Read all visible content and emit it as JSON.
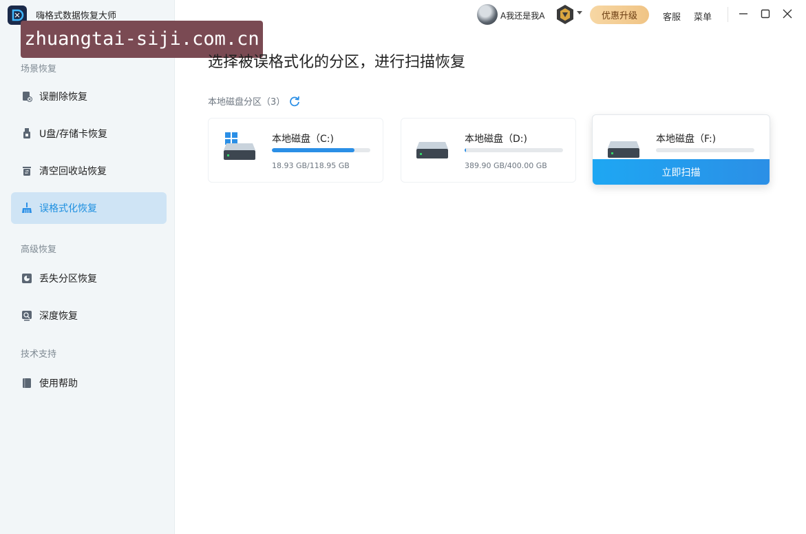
{
  "app": {
    "title": "嗨格式数据恢复大师",
    "logo_letter": "D",
    "watermark": "zhuangtai-siji.com.cn"
  },
  "header": {
    "username": "A我还是我A",
    "upgrade_label": "优惠升级",
    "service_label": "客服",
    "menu_label": "菜单"
  },
  "sidebar": {
    "section_scene": "场景恢复",
    "section_advanced": "高级恢复",
    "section_support": "技术支持",
    "items": [
      {
        "label": "误删除恢复",
        "icon": "file-delete-icon"
      },
      {
        "label": "U盘/存储卡恢复",
        "icon": "usb-drive-icon"
      },
      {
        "label": "清空回收站恢复",
        "icon": "recycle-bin-icon"
      },
      {
        "label": "误格式化恢复",
        "icon": "broom-icon",
        "active": true
      },
      {
        "label": "丢失分区恢复",
        "icon": "partition-icon"
      },
      {
        "label": "深度恢复",
        "icon": "deep-scan-icon"
      },
      {
        "label": "使用帮助",
        "icon": "help-book-icon"
      }
    ]
  },
  "main": {
    "title": "选择被误格式化的分区，进行扫描恢复",
    "subtitle": "本地磁盘分区（3）",
    "disks": [
      {
        "name": "本地磁盘（C:)",
        "size": "18.93 GB/118.95 GB",
        "usage": 0.84,
        "system": true
      },
      {
        "name": "本地磁盘（D:)",
        "size": "389.90 GB/400.00 GB",
        "usage": 0.01
      },
      {
        "name": "本地磁盘（F:)",
        "size": "",
        "usage": 0.0,
        "selected": true
      }
    ],
    "scan_button": "立即扫描"
  },
  "colors": {
    "accent": "#2b8fe6",
    "active_nav_bg": "#cfe4f5",
    "upgrade_bg": "#f0c485"
  }
}
